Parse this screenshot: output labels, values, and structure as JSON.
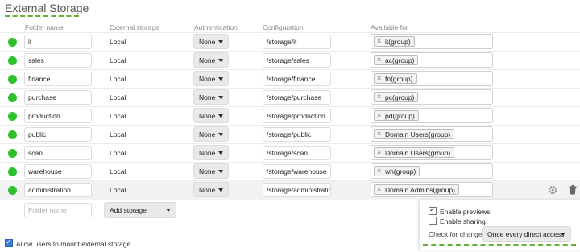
{
  "page": {
    "title": "External Storage"
  },
  "columns": {
    "folder_name": "Folder name",
    "external_storage": "External storage",
    "authentication": "Authentication",
    "configuration": "Configuration",
    "available_for": "Available for"
  },
  "mounts": [
    {
      "folder": "it",
      "storage": "Local",
      "auth": "None",
      "config": "/storage/it",
      "available": "it(group)"
    },
    {
      "folder": "sales",
      "storage": "Local",
      "auth": "None",
      "config": "/storage/sales",
      "available": "ac(group)"
    },
    {
      "folder": "finance",
      "storage": "Local",
      "auth": "None",
      "config": "/storage/finance",
      "available": "fn(group)"
    },
    {
      "folder": "purchase",
      "storage": "Local",
      "auth": "None",
      "config": "/storage/purchase",
      "available": "pc(group)"
    },
    {
      "folder": "production",
      "storage": "Local",
      "auth": "None",
      "config": "/storage/production",
      "available": "pd(group)"
    },
    {
      "folder": "public",
      "storage": "Local",
      "auth": "None",
      "config": "/storage/public",
      "available": "Domain Users(group)"
    },
    {
      "folder": "scan",
      "storage": "Local",
      "auth": "None",
      "config": "/storage/scan",
      "available": "Domain Users(group)"
    },
    {
      "folder": "warehouse",
      "storage": "Local",
      "auth": "None",
      "config": "/storage/warehouse",
      "available": "wh(group)"
    },
    {
      "folder": "administration",
      "storage": "Local",
      "auth": "None",
      "config": "/storage/administratio",
      "available": "Domain Admins(group)"
    }
  ],
  "new_row": {
    "folder_placeholder": "Folder name",
    "add_storage": "Add storage"
  },
  "options_popup": {
    "enable_previews": "Enable previews",
    "enable_sharing": "Enable sharing",
    "check_for_changes_label": "Check for changes",
    "check_for_changes_value": "Once every direct access"
  },
  "footer": {
    "allow_users_mount": "Allow users to mount external storage"
  },
  "colors": {
    "status_ok": "#2dc12d",
    "accent_dash": "#64b034",
    "checkbox_blue": "#3d7ad6"
  },
  "icons": {
    "row_status": "status-dot-icon",
    "chip_remove": "close-icon",
    "settings": "gear-icon",
    "delete": "trash-icon",
    "dropdown": "caret-down-icon"
  }
}
